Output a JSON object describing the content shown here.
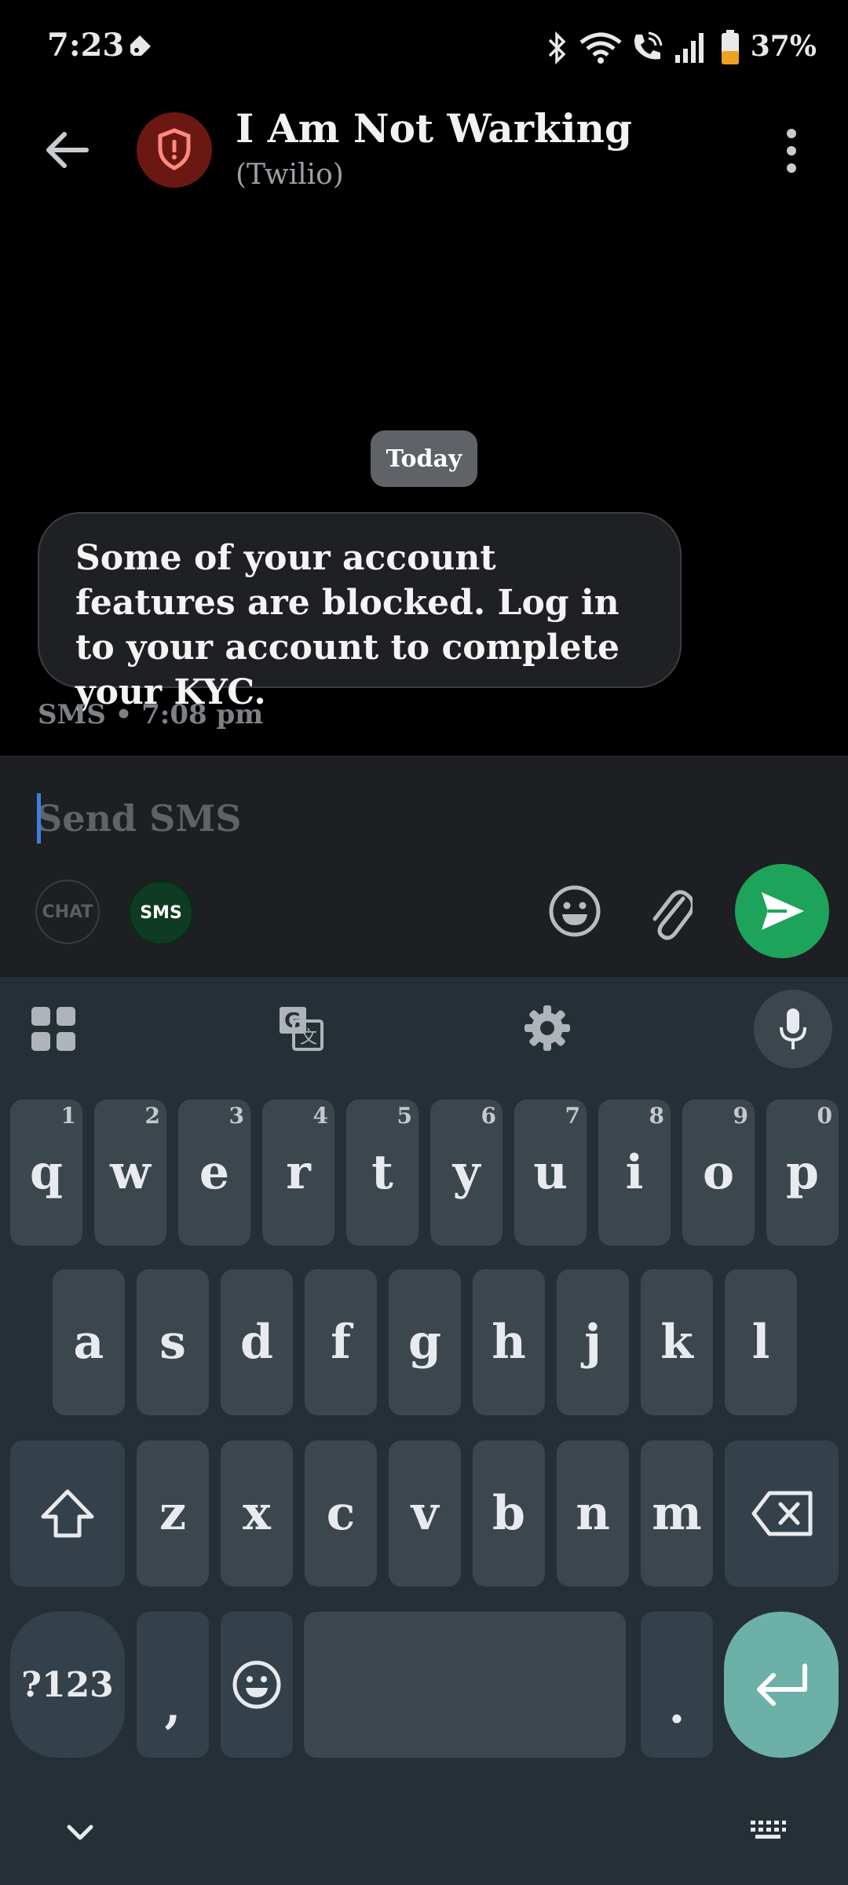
{
  "status_bar": {
    "time": "7:23",
    "battery": "37%"
  },
  "header": {
    "title": "I Am Not Warking",
    "subtitle": "(Twilio)"
  },
  "conversation": {
    "date_chip": "Today",
    "message": "Some of your account features are blocked. Log in to your account to complete your KYC.",
    "meta": "SMS • 7:08 pm"
  },
  "compose": {
    "placeholder": "Send SMS",
    "chat_label": "CHAT",
    "sms_label": "SMS"
  },
  "keyboard": {
    "row1": [
      {
        "k": "q",
        "n": "1"
      },
      {
        "k": "w",
        "n": "2"
      },
      {
        "k": "e",
        "n": "3"
      },
      {
        "k": "r",
        "n": "4"
      },
      {
        "k": "t",
        "n": "5"
      },
      {
        "k": "y",
        "n": "6"
      },
      {
        "k": "u",
        "n": "7"
      },
      {
        "k": "i",
        "n": "8"
      },
      {
        "k": "o",
        "n": "9"
      },
      {
        "k": "p",
        "n": "0"
      }
    ],
    "row2": [
      "a",
      "s",
      "d",
      "f",
      "g",
      "h",
      "j",
      "k",
      "l"
    ],
    "row3": [
      "z",
      "x",
      "c",
      "v",
      "b",
      "n",
      "m"
    ],
    "symbols_label": "?123",
    "comma": ",",
    "period": "."
  },
  "colors": {
    "send": "#1ea45a",
    "sms_chip": "#0f3b24",
    "accent": "#3d7fe0",
    "avatar": "#6b1812"
  }
}
